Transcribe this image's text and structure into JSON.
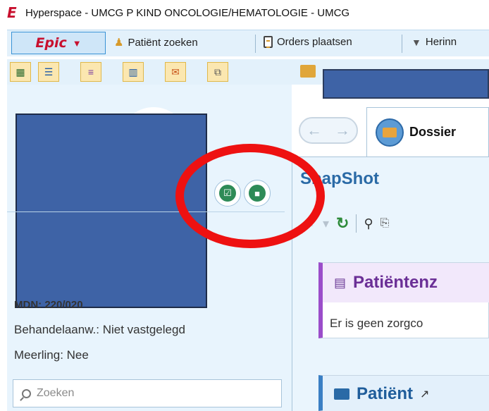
{
  "window": {
    "logo_letter": "E",
    "title": "Hyperspace - UMCG P KIND ONCOLOGIE/HEMATOLOGIE - UMCG"
  },
  "toolbar": {
    "epic_label": "Epic",
    "epic_caret": "▼",
    "items": [
      {
        "label": "Patiënt zoeken",
        "icon": "person-search-icon"
      },
      {
        "label": "Orders plaatsen",
        "icon": "clipboard-icon"
      },
      {
        "label": "Herinn",
        "icon": "funnel-icon"
      }
    ]
  },
  "toolbar2": {
    "buttons": [
      {
        "icon": "calendar-icon",
        "glyph": "▦"
      },
      {
        "icon": "patient-list-icon",
        "glyph": "☰"
      },
      {
        "icon": "list-icon",
        "glyph": "≡"
      },
      {
        "icon": "chart-icon",
        "glyph": "▥"
      },
      {
        "icon": "envelope-icon",
        "glyph": "✉"
      },
      {
        "icon": "windows-icon",
        "glyph": "⧉"
      }
    ]
  },
  "patient_header": {
    "icons": [
      "checklist-icon",
      "video-icon"
    ],
    "mrn_fragment": "MDN: 220/020",
    "treatment_label": "Behandelaanw.: Niet vastgelegd",
    "multiple_birth": "Meerling: Nee",
    "search_placeholder": "Zoeken"
  },
  "activity": {
    "nav_back": "←",
    "nav_forward": "→",
    "tab_label": "Dossier",
    "snapshot_title": "SnapShot",
    "tools": {
      "back": "←",
      "dropdown": "▾",
      "refresh": "↻",
      "binoculars": "⚲",
      "copy": "⎘"
    },
    "card1_title": "Patiëntenz",
    "card1_body": "Er is geen zorgco",
    "card2_title": "Patiënt",
    "card2_ext": "↗"
  },
  "annotation": {
    "color": "#ee1111"
  }
}
